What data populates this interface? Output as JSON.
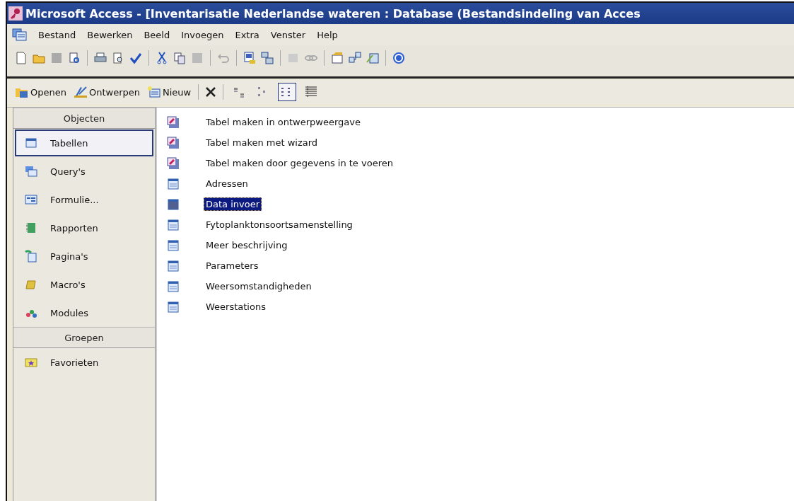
{
  "window": {
    "title": "Microsoft Access - [Inventarisatie Nederlandse wateren : Database (Bestandsindeling van Acces"
  },
  "menu": [
    "Bestand",
    "Bewerken",
    "Beeld",
    "Invoegen",
    "Extra",
    "Venster",
    "Help"
  ],
  "db_toolbar": [
    {
      "kind": "open",
      "label": "Openen"
    },
    {
      "kind": "design",
      "label": "Ontwerpen"
    },
    {
      "kind": "new",
      "label": "Nieuw"
    }
  ],
  "view_buttons": [
    {
      "kind": "large",
      "selected": false
    },
    {
      "kind": "small",
      "selected": false
    },
    {
      "kind": "list",
      "selected": true
    },
    {
      "kind": "details",
      "selected": false
    }
  ],
  "sidebar": {
    "objects_header": "Objecten",
    "items": [
      {
        "kind": "table",
        "label": "Tabellen",
        "selected": true
      },
      {
        "kind": "query",
        "label": "Query's",
        "selected": false
      },
      {
        "kind": "form",
        "label": "Formulie...",
        "selected": false
      },
      {
        "kind": "report",
        "label": "Rapporten",
        "selected": false
      },
      {
        "kind": "page",
        "label": "Pagina's",
        "selected": false
      },
      {
        "kind": "macro",
        "label": "Macro's",
        "selected": false
      },
      {
        "kind": "module",
        "label": "Modules",
        "selected": false
      }
    ],
    "groups_header": "Groepen",
    "groups": [
      {
        "kind": "favorite",
        "label": "Favorieten",
        "selected": false
      }
    ]
  },
  "objects": [
    {
      "kind": "wizard",
      "label": "Tabel maken in ontwerpweergave",
      "selected": false
    },
    {
      "kind": "wizard",
      "label": "Tabel maken met wizard",
      "selected": false
    },
    {
      "kind": "wizard",
      "label": "Tabel maken door gegevens in te voeren",
      "selected": false
    },
    {
      "kind": "table",
      "label": "Adressen",
      "selected": false
    },
    {
      "kind": "table",
      "label": "Data invoer",
      "selected": true
    },
    {
      "kind": "table",
      "label": "Fytoplanktonsoortsamenstelling",
      "selected": false
    },
    {
      "kind": "table",
      "label": "Meer beschrijving",
      "selected": false
    },
    {
      "kind": "table",
      "label": "Parameters",
      "selected": false
    },
    {
      "kind": "table",
      "label": "Weersomstandigheden",
      "selected": false
    },
    {
      "kind": "table",
      "label": "Weerstations",
      "selected": false
    }
  ]
}
